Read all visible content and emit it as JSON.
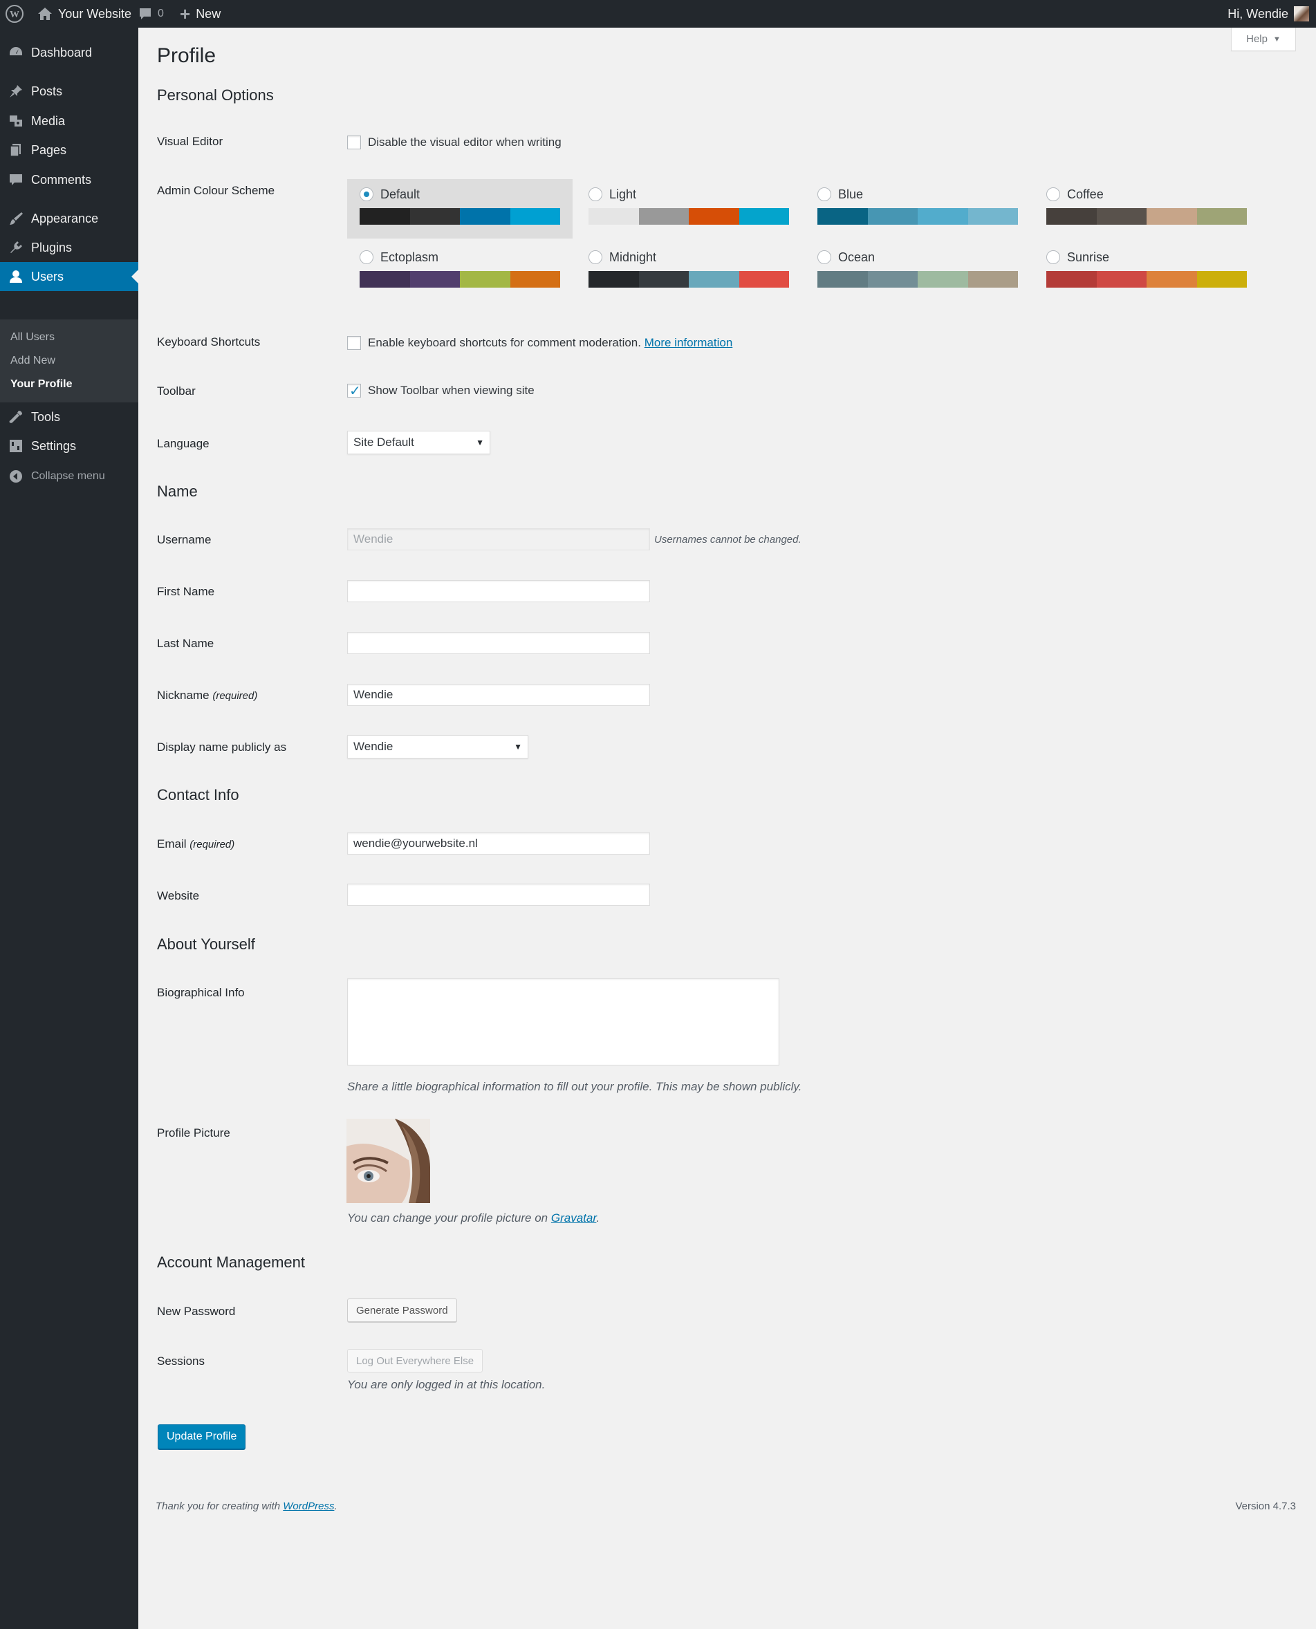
{
  "adminbar": {
    "site_name": "Your Website",
    "comments_count": "0",
    "new_label": "New",
    "greeting": "Hi, Wendie"
  },
  "menu": {
    "items": [
      {
        "label": "Dashboard",
        "icon": "dashboard-icon"
      },
      {
        "label": "Posts",
        "icon": "pin-icon"
      },
      {
        "label": "Media",
        "icon": "media-icon"
      },
      {
        "label": "Pages",
        "icon": "pages-icon"
      },
      {
        "label": "Comments",
        "icon": "comment-icon"
      },
      {
        "label": "Appearance",
        "icon": "brush-icon"
      },
      {
        "label": "Plugins",
        "icon": "plug-icon"
      },
      {
        "label": "Users",
        "icon": "user-icon"
      },
      {
        "label": "Tools",
        "icon": "wrench-icon"
      },
      {
        "label": "Settings",
        "icon": "settings-icon"
      }
    ],
    "submenu": [
      "All Users",
      "Add New",
      "Your Profile"
    ],
    "collapse_label": "Collapse menu"
  },
  "help_label": "Help",
  "page_title": "Profile",
  "sections": {
    "personal_options": "Personal Options",
    "name": "Name",
    "contact_info": "Contact Info",
    "about_yourself": "About Yourself",
    "account_management": "Account Management"
  },
  "visual_editor": {
    "label": "Visual Editor",
    "checkbox_label": "Disable the visual editor when writing",
    "checked": false
  },
  "colour_scheme": {
    "label": "Admin Colour Scheme",
    "selected": "Default",
    "schemes": [
      {
        "name": "Default",
        "colors": [
          "#222222",
          "#333333",
          "#0073aa",
          "#00a0d2"
        ]
      },
      {
        "name": "Light",
        "colors": [
          "#e5e5e5",
          "#999999",
          "#d64e07",
          "#04a4cc"
        ]
      },
      {
        "name": "Blue",
        "colors": [
          "#096484",
          "#4796b3",
          "#52accc",
          "#74b6ce"
        ]
      },
      {
        "name": "Coffee",
        "colors": [
          "#46403c",
          "#59524c",
          "#c7a589",
          "#9ea476"
        ]
      },
      {
        "name": "Ectoplasm",
        "colors": [
          "#413256",
          "#523f6d",
          "#a3b745",
          "#d46f15"
        ]
      },
      {
        "name": "Midnight",
        "colors": [
          "#25282b",
          "#363b3f",
          "#69a8bb",
          "#e14d43"
        ]
      },
      {
        "name": "Ocean",
        "colors": [
          "#627c83",
          "#738e96",
          "#9ebaa0",
          "#aa9d88"
        ]
      },
      {
        "name": "Sunrise",
        "colors": [
          "#b43c38",
          "#cf4944",
          "#dd823b",
          "#ccaf0b"
        ]
      }
    ]
  },
  "keyboard_shortcuts": {
    "label": "Keyboard Shortcuts",
    "checkbox_label": "Enable keyboard shortcuts for comment moderation.",
    "link": "More information",
    "checked": false
  },
  "toolbar": {
    "label": "Toolbar",
    "checkbox_label": "Show Toolbar when viewing site",
    "checked": true
  },
  "language": {
    "label": "Language",
    "value": "Site Default"
  },
  "username": {
    "label": "Username",
    "value": "Wendie",
    "note": "Usernames cannot be changed."
  },
  "first_name": {
    "label": "First Name",
    "value": ""
  },
  "last_name": {
    "label": "Last Name",
    "value": ""
  },
  "nickname": {
    "label": "Nickname",
    "required": "(required)",
    "value": "Wendie"
  },
  "display_name": {
    "label": "Display name publicly as",
    "value": "Wendie"
  },
  "email": {
    "label": "Email",
    "required": "(required)",
    "value": "wendie@yourwebsite.nl"
  },
  "website": {
    "label": "Website",
    "value": ""
  },
  "bio": {
    "label": "Biographical Info",
    "value": "",
    "description": "Share a little biographical information to fill out your profile. This may be shown publicly."
  },
  "profile_picture": {
    "label": "Profile Picture",
    "description_prefix": "You can change your profile picture on ",
    "link": "Gravatar",
    "description_suffix": "."
  },
  "new_password": {
    "label": "New Password",
    "button": "Generate Password"
  },
  "sessions": {
    "label": "Sessions",
    "button": "Log Out Everywhere Else",
    "description": "You are only logged in at this location."
  },
  "update_button": "Update Profile",
  "footer": {
    "thanks_prefix": "Thank you for creating with ",
    "thanks_link": "WordPress",
    "thanks_suffix": ".",
    "version": "Version 4.7.3"
  }
}
